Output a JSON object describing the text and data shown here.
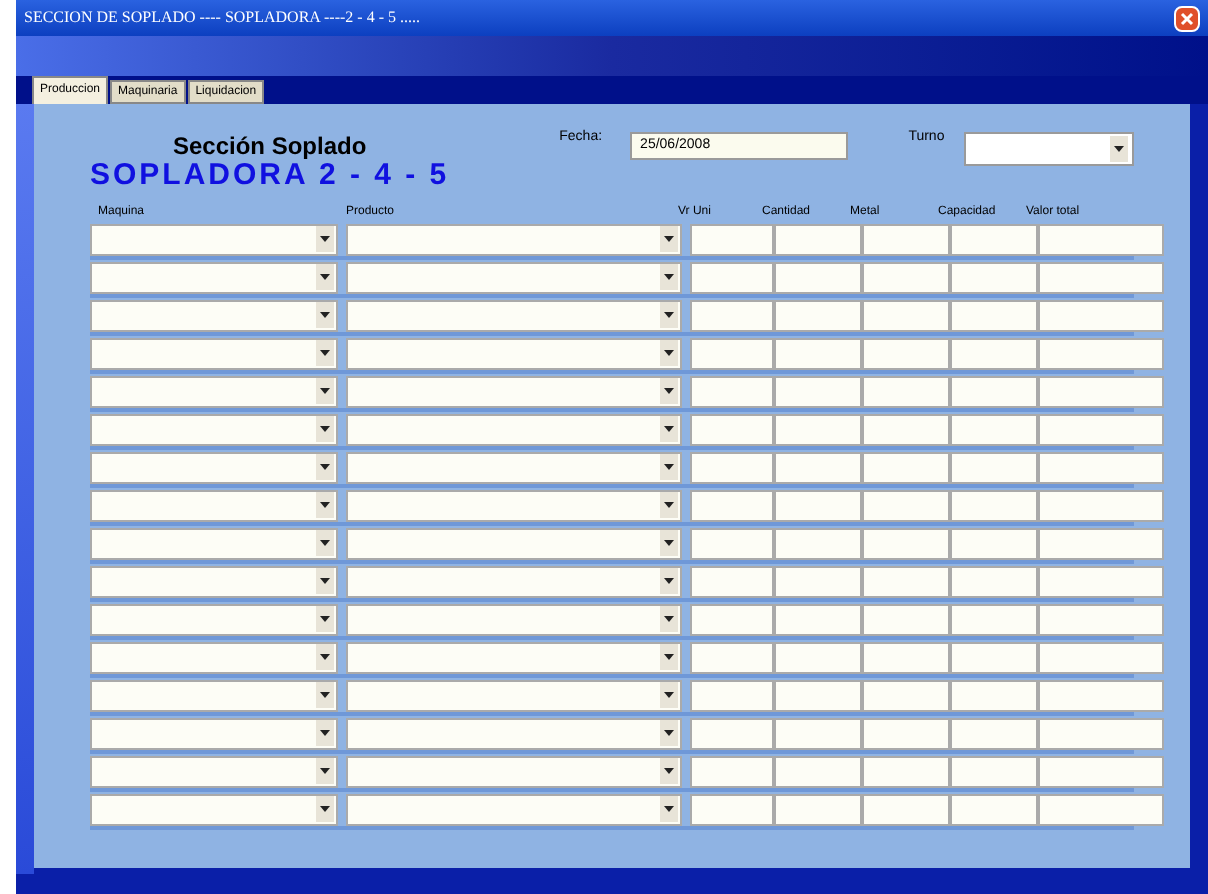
{
  "window": {
    "title": "SECCION DE SOPLADO ---- SOPLADORA ----2  -  4  -  5 ....."
  },
  "tabs": [
    {
      "label": "Produccion",
      "selected": true
    },
    {
      "label": "Maquinaria",
      "selected": false
    },
    {
      "label": "Liquidacion",
      "selected": false
    }
  ],
  "header": {
    "subtitle": "Sección Soplado",
    "title": "SOPLADORA 2 - 4 - 5"
  },
  "fecha": {
    "label": "Fecha:",
    "value": "25/06/2008"
  },
  "turno": {
    "label": "Turno"
  },
  "table": {
    "columns": [
      {
        "label": "Maquina",
        "kind": "combo"
      },
      {
        "label": "Producto",
        "kind": "combo"
      },
      {
        "label": "Vr Uni",
        "kind": "text"
      },
      {
        "label": "Cantidad",
        "kind": "text"
      },
      {
        "label": "Metal",
        "kind": "text"
      },
      {
        "label": "Capacidad",
        "kind": "text"
      },
      {
        "label": "Valor total",
        "kind": "text"
      }
    ],
    "rows": [
      {
        "kind": "entry"
      },
      {
        "kind": "entry"
      },
      {
        "kind": "entry"
      },
      {
        "kind": "entry"
      },
      {
        "kind": "entry"
      },
      {
        "kind": "entry"
      },
      {
        "kind": "entry"
      },
      {
        "kind": "entry"
      },
      {
        "kind": "entry"
      },
      {
        "kind": "entry"
      },
      {
        "kind": "entry"
      },
      {
        "kind": "entry"
      },
      {
        "kind": "entry"
      },
      {
        "kind": "entry"
      },
      {
        "kind": "entry"
      },
      {
        "kind": "entry"
      }
    ]
  }
}
